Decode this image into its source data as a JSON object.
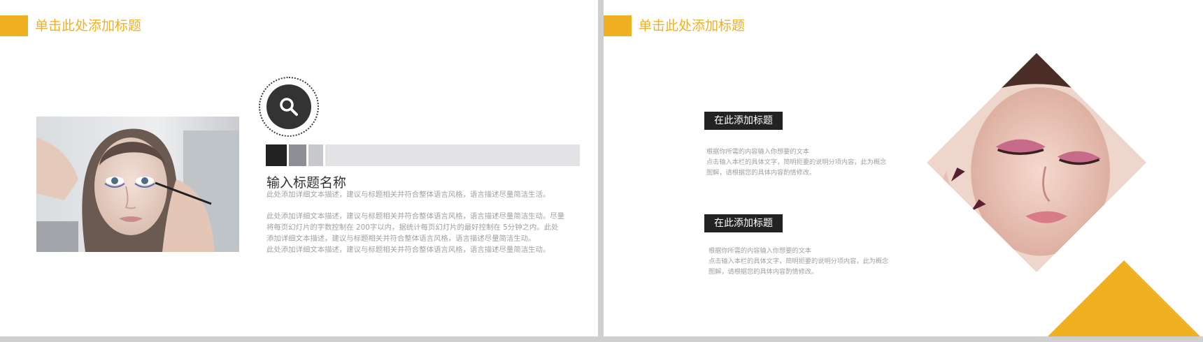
{
  "colors": {
    "accent": "#efb121",
    "dark": "#222222",
    "muted": "#a0a0a0"
  },
  "left_slide": {
    "title": "单击此处添加标题",
    "icon": "search-icon",
    "heading": "输入标题名称",
    "subline": "此处添加详细文本描述，建议与标题相关并符合整体语言风格，语言描述尽量简洁生活。",
    "paragraph_lines": [
      "此处添加详细文本描述，建议与标题相关并符合整体语言风格，语言描述尽量简洁生动。尽量",
      "将每页幻灯片的字数控制在  200字以内，据统计每页幻灯片的最好控制在  5分钟之内。此处",
      "添加详细文本描述，建议与标题相关并符合整体语言风格，语言描述尽量简洁生动。",
      "此处添加详细文本描述，建议与标题相关并符合整体语言风格，语言描述尽量简洁生动。"
    ]
  },
  "right_slide": {
    "title": "单击此处添加标题",
    "blocks": [
      {
        "label": "在此添加标题",
        "lines": [
          "根据你所需的内容输入你想要的文本",
          "点击输入本栏的具体文字，简明扼要的说明分项内容，此为概念",
          "图解，请根据您的具体内容酌情修改。"
        ]
      },
      {
        "label": "在此添加标题",
        "lines": [
          "根据你所需的内容输入你想要的文本",
          "点击输入本栏的具体文字，简明扼要的说明分项内容，此为概念",
          "图解，请根据您的具体内容酌情修改。"
        ]
      }
    ]
  }
}
